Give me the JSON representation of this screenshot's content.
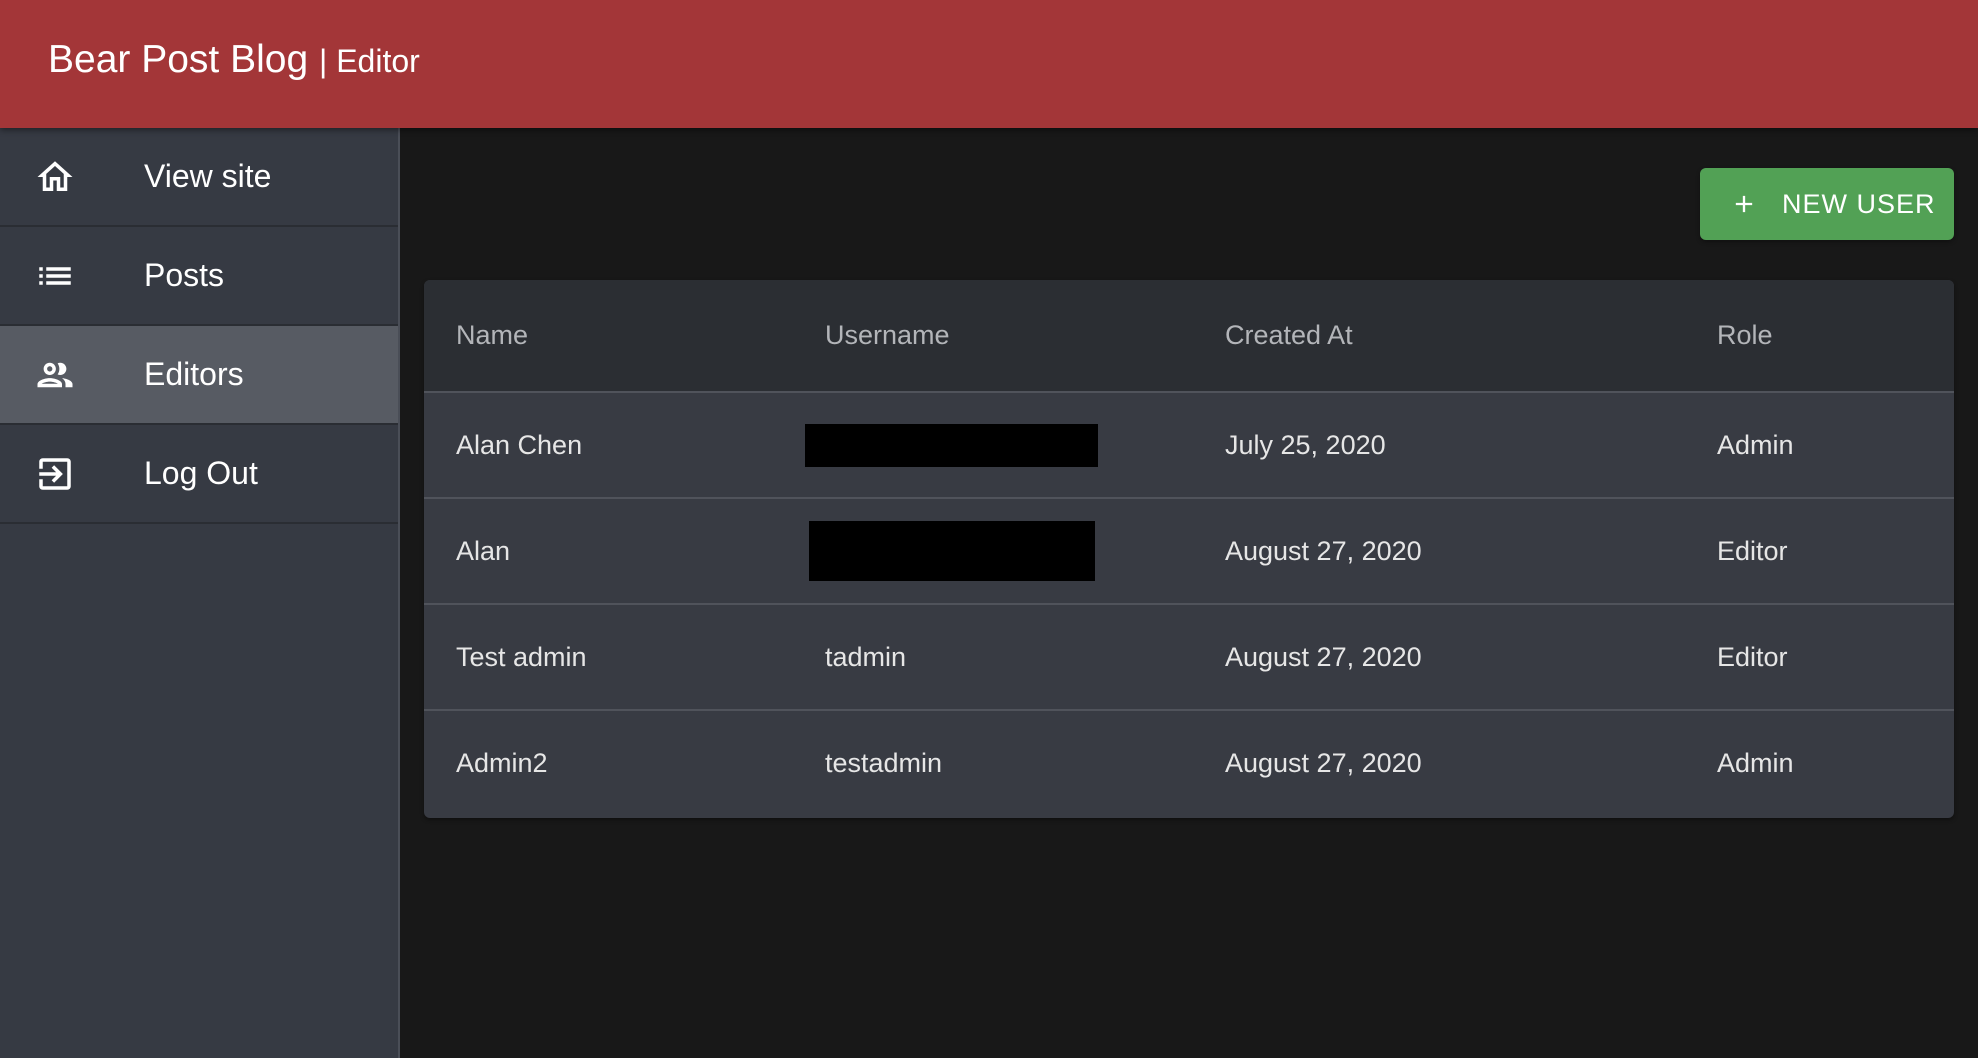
{
  "header": {
    "title": "Bear Post Blog",
    "separator": "| Editor"
  },
  "sidebar": {
    "items": [
      {
        "label": "View site",
        "icon": "home-icon"
      },
      {
        "label": "Posts",
        "icon": "list-icon"
      },
      {
        "label": "Editors",
        "icon": "people-icon",
        "active": true
      },
      {
        "label": "Log Out",
        "icon": "logout-icon"
      }
    ]
  },
  "toolbar": {
    "new_user_label": "NEW USER",
    "new_user_icon": "plus-icon"
  },
  "table": {
    "headers": [
      "Name",
      "Username",
      "Created At",
      "Role"
    ],
    "rows": [
      {
        "name": "Alan Chen",
        "username": "",
        "username_redacted": true,
        "created_at": "July 25, 2020",
        "role": "Admin"
      },
      {
        "name": "Alan",
        "username": "",
        "username_redacted": true,
        "created_at": "August 27, 2020",
        "role": "Editor"
      },
      {
        "name": "Test admin",
        "username": "tadmin",
        "created_at": "August 27, 2020",
        "role": "Editor"
      },
      {
        "name": "Admin2",
        "username": "testadmin",
        "created_at": "August 27, 2020",
        "role": "Admin"
      }
    ]
  },
  "colors": {
    "appbar": "#a33638",
    "sidebar": "#363a43",
    "sidebar_active": "#575b63",
    "background": "#181818",
    "button": "#52a155"
  }
}
